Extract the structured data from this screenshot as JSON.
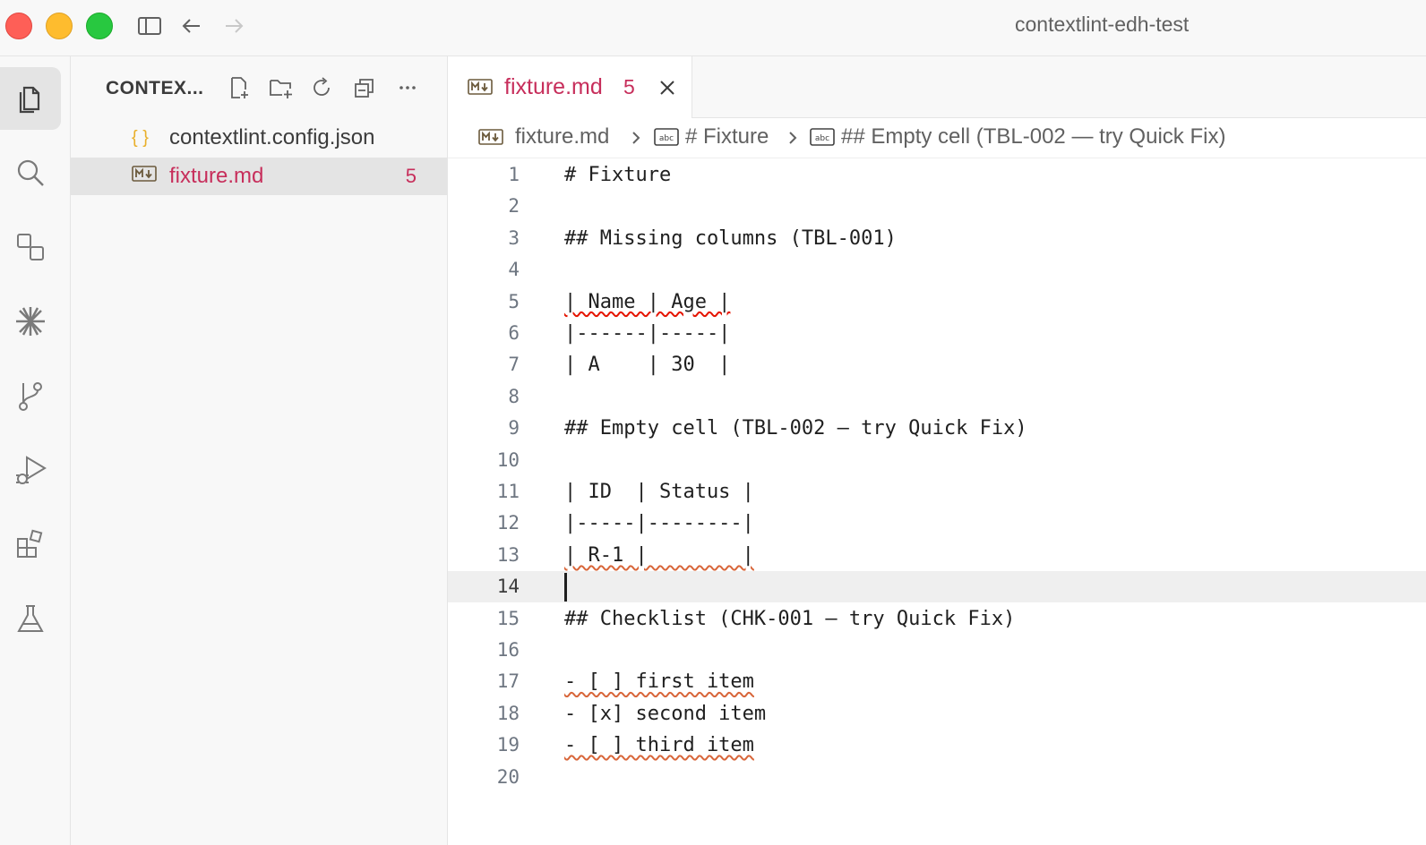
{
  "window": {
    "title": "contextlint-edh-test"
  },
  "sidebar": {
    "title": "CONTEX...",
    "files": [
      {
        "name": "contextlint.config.json",
        "icon": "json-braces-icon",
        "icon_text": "{ }",
        "badge": ""
      },
      {
        "name": "fixture.md",
        "icon": "markdown-file-icon",
        "badge": "5"
      }
    ]
  },
  "tab": {
    "label": "fixture.md",
    "badge": "5",
    "md_icon_text": "M↓"
  },
  "breadcrumb": {
    "file": "fixture.md",
    "heading1": "# Fixture",
    "heading2": "## Empty cell (TBL-002 — try Quick Fix)"
  },
  "editor": {
    "current_line": 14,
    "lines": [
      "# Fixture",
      "",
      "## Missing columns (TBL-001)",
      "",
      "| Name | Age |",
      "|------|-----|",
      "| A    | 30  |",
      "",
      "## Empty cell (TBL-002 — try Quick Fix)",
      "",
      "| ID  | Status |",
      "|-----|--------|",
      "| R-1 |        |",
      "",
      "## Checklist (CHK-001 — try Quick Fix)",
      "",
      "- [ ] first item",
      "- [x] second item",
      "- [ ] third item",
      ""
    ],
    "squiggle_lines": [
      5,
      13,
      17,
      19
    ]
  },
  "colors": {
    "error": "#c72e5b",
    "accent_red": "#e51400"
  }
}
